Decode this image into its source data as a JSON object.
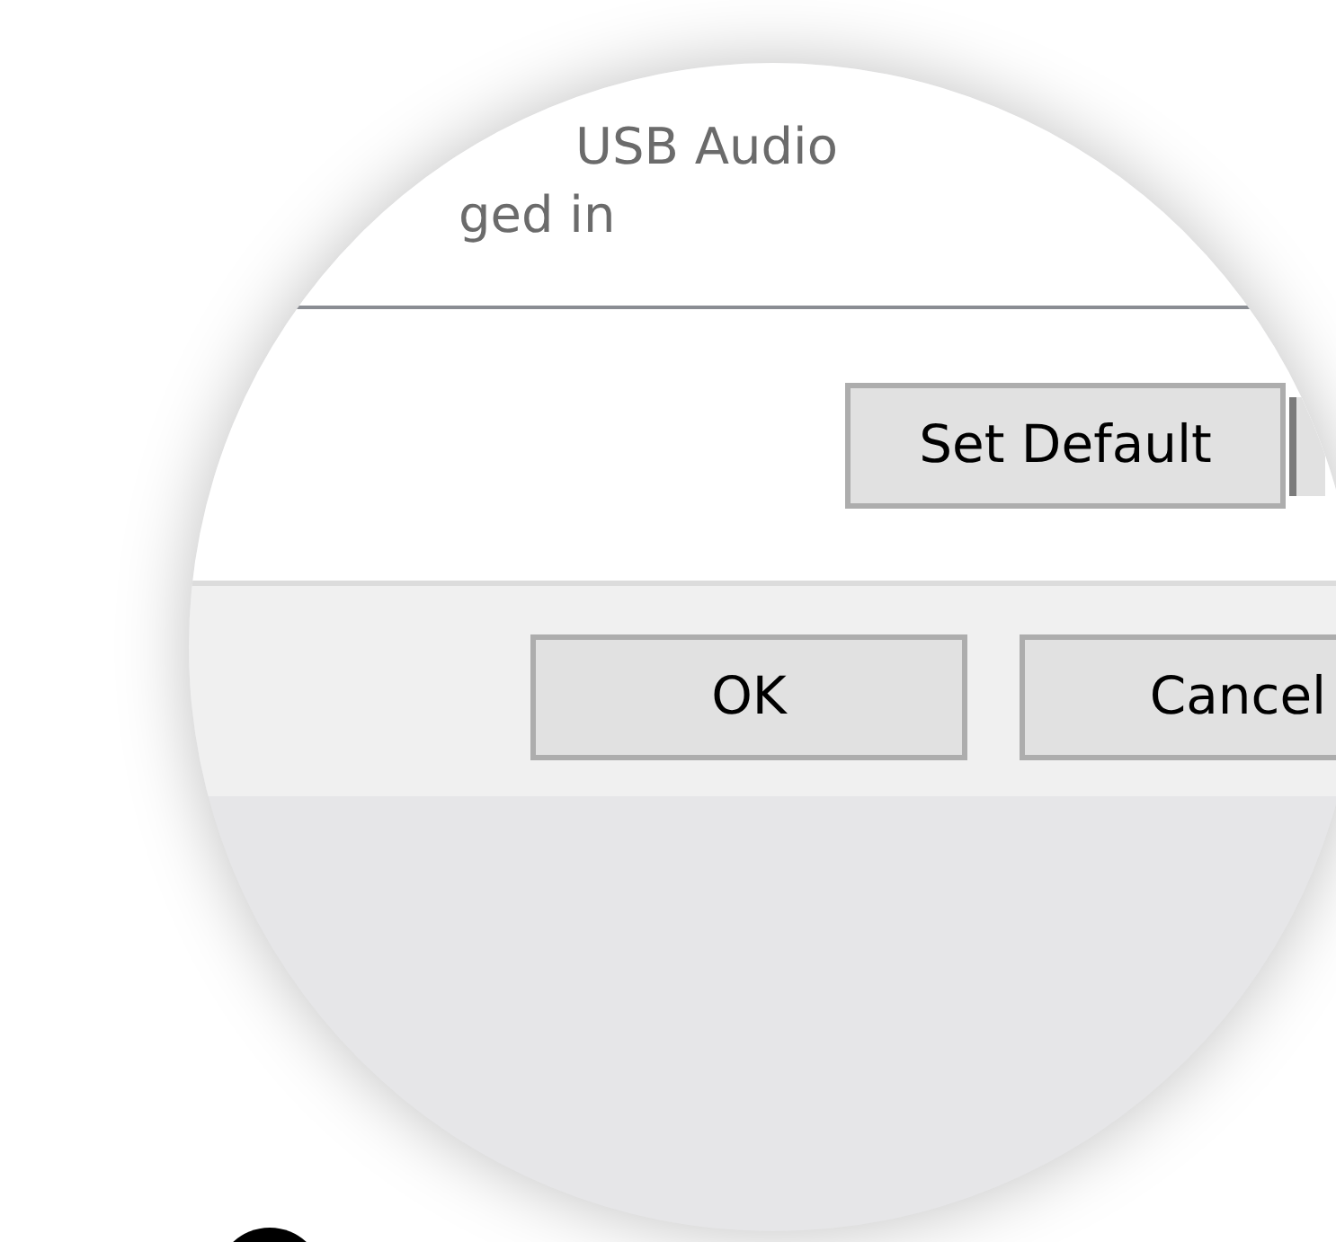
{
  "magnifier": {
    "status_lines": [
      "USB Audio",
      "ged in"
    ],
    "action_button": {
      "label": "Set Default"
    },
    "dialog_buttons": [
      {
        "label": "OK"
      },
      {
        "label": "Cancel"
      }
    ]
  }
}
